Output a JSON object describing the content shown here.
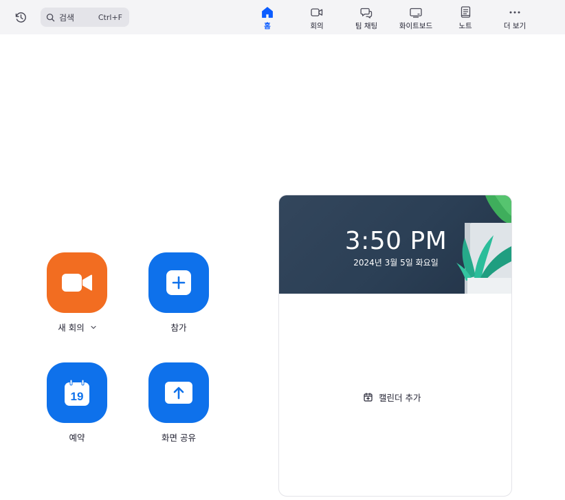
{
  "topbar": {
    "history_icon": "history-clock-icon",
    "search": {
      "placeholder": "검색",
      "shortcut": "Ctrl+F",
      "icon": "search-icon"
    },
    "nav": [
      {
        "label": "홈",
        "icon": "home-icon",
        "active": true
      },
      {
        "label": "회의",
        "icon": "video-camera-icon"
      },
      {
        "label": "팀 채팅",
        "icon": "chat-bubbles-icon"
      },
      {
        "label": "화이트보드",
        "icon": "whiteboard-icon"
      },
      {
        "label": "노트",
        "icon": "notes-icon"
      },
      {
        "label": "더 보기",
        "icon": "more-dots-icon"
      }
    ],
    "accent": "#0b5cff"
  },
  "actions": [
    {
      "label": "새 회의",
      "icon": "video-camera-icon",
      "color": "#f26d21",
      "has_dropdown": true
    },
    {
      "label": "참가",
      "icon": "plus-icon",
      "color": "#0e71eb"
    },
    {
      "label": "예약",
      "icon": "calendar-icon",
      "calendar_day": "19",
      "color": "#0e71eb"
    },
    {
      "label": "화면 공유",
      "icon": "share-screen-icon",
      "color": "#0e71eb"
    }
  ],
  "calendar_card": {
    "time": "3:50 PM",
    "date": "2024년 3월 5일 화요일",
    "add_calendar_label": "캘린더 추가",
    "add_calendar_icon": "calendar-add-icon"
  }
}
